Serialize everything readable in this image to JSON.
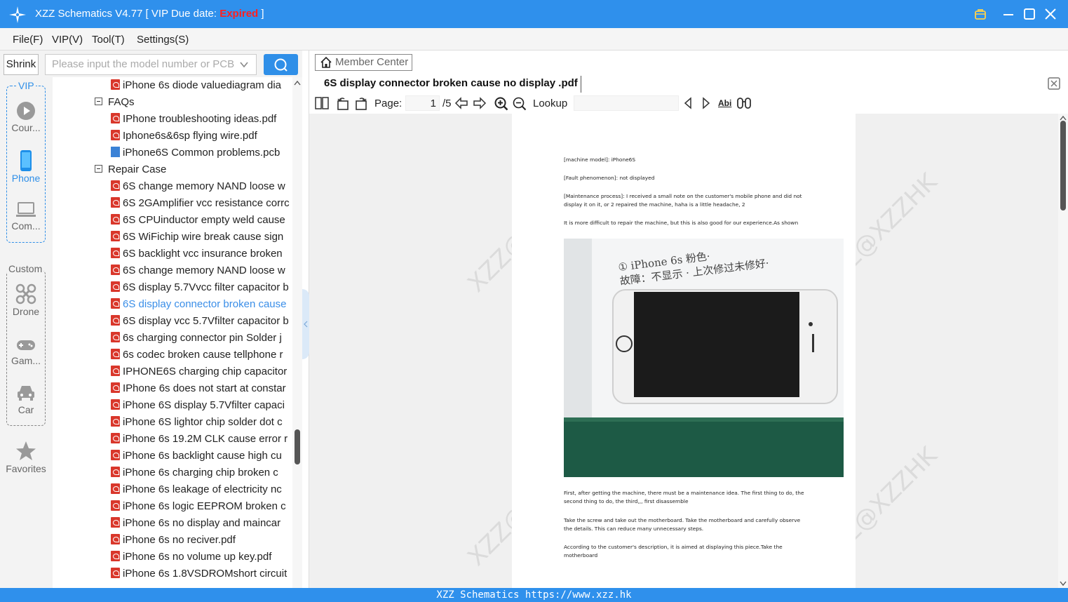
{
  "window": {
    "title_prefix": "XZZ Schematics V4.77 [ VIP Due date: ",
    "title_status": "Expired",
    "title_suffix": " ]"
  },
  "menu": [
    "File(F)",
    "VIP(V)",
    "Tool(T)",
    "Settings(S)"
  ],
  "sidebar": {
    "shrink_label": "Shrink",
    "search_placeholder": "Please input the model number or PCB",
    "vip_group_label": "VIP",
    "custom_group_label": "Custom",
    "items": [
      {
        "label": "Cour...",
        "icon": "play-circle-icon"
      },
      {
        "label": "Phone",
        "icon": "phone-icon"
      },
      {
        "label": "Com...",
        "icon": "laptop-icon"
      },
      {
        "label": "Drone",
        "icon": "drone-icon"
      },
      {
        "label": "Gam...",
        "icon": "gamepad-icon"
      },
      {
        "label": "Car",
        "icon": "car-icon"
      },
      {
        "label": "Favorites",
        "icon": "star-icon"
      }
    ]
  },
  "tree": {
    "nodes": [
      {
        "type": "pdf",
        "label": "iPhone 6s diode valuediagram dia"
      },
      {
        "type": "folder",
        "label": "FAQs"
      },
      {
        "type": "pdf",
        "label": "IPhone troubleshooting ideas.pdf"
      },
      {
        "type": "pdf",
        "label": "Iphone6s&6sp flying wire.pdf"
      },
      {
        "type": "pcb",
        "label": "iPhone6S Common problems.pcb"
      },
      {
        "type": "folder",
        "label": "Repair Case"
      },
      {
        "type": "pdf",
        "label": "6S  change memory NAND loose w"
      },
      {
        "type": "pdf",
        "label": "6S 2GAmplifier vcc resistance corrc"
      },
      {
        "type": "pdf",
        "label": "6S CPUinductor empty weld cause"
      },
      {
        "type": "pdf",
        "label": "6S WiFichip wire break  cause sign"
      },
      {
        "type": "pdf",
        "label": "6S backlight vcc insurance broken"
      },
      {
        "type": "pdf",
        "label": "6S change memory NAND loose w"
      },
      {
        "type": "pdf",
        "label": "6S display 5.7Vvcc filter capacitor b"
      },
      {
        "type": "pdf",
        "label": "6S display connector broken cause",
        "selected": true
      },
      {
        "type": "pdf",
        "label": "6S display vcc 5.7Vfilter capacitor b"
      },
      {
        "type": "pdf",
        "label": "6s charging connector pin Solder j"
      },
      {
        "type": "pdf",
        "label": "6s codec broken cause tellphone r"
      },
      {
        "type": "pdf",
        "label": "IPHONE6S charging chip capacitor"
      },
      {
        "type": "pdf",
        "label": "IPhone 6s does not start at constar"
      },
      {
        "type": "pdf",
        "label": "iPhone 6S display 5.7Vfilter capaci"
      },
      {
        "type": "pdf",
        "label": "iPhone 6S lightor chip solder dot c"
      },
      {
        "type": "pdf",
        "label": "iPhone 6s  19.2M CLK cause error r"
      },
      {
        "type": "pdf",
        "label": "iPhone 6s  backlight cause high cu"
      },
      {
        "type": "pdf",
        "label": "iPhone 6s  charging chip broken c"
      },
      {
        "type": "pdf",
        "label": "iPhone 6s  leakage of electricity nc"
      },
      {
        "type": "pdf",
        "label": "iPhone 6s  logic EEPROM broken c"
      },
      {
        "type": "pdf",
        "label": "iPhone 6s  no display and maincar"
      },
      {
        "type": "pdf",
        "label": "iPhone 6s  no reciver.pdf"
      },
      {
        "type": "pdf",
        "label": "iPhone 6s  no volume up key.pdf"
      },
      {
        "type": "pdf",
        "label": "iPhone 6s 1.8VSDROMshort circuit"
      }
    ]
  },
  "viewer": {
    "member_center": "Member Center",
    "doc_tab": "6S display connector broken cause no display  .pdf",
    "page_label": "Page:",
    "page_current": "1",
    "page_total": "/5",
    "lookup_label": "Lookup",
    "abi_label": "Abi",
    "watermark": "XZZ@XZZHK",
    "page_text": [
      "[machine model]: iPhone6S",
      "[Fault phenomenon]: not displayed",
      "[Maintenance process]: I received a small note on the customer's mobile phone and did not display it on it, or 2 repaired the machine, haha is a little headache, 2",
      "It is more difficult to repair the machine, but this is also good for our experience.As shown",
      "First, after getting the machine, there must be a maintenance idea. The first thing to do, the second thing to do, the third,,, first disassemble",
      "Take the screw and take out the motherboard. Take the motherboard and carefully observe the details. This can reduce many unnecessary steps.",
      "According to the customer's description, it is aimed at displaying this piece.Take the motherboard"
    ],
    "photo_note": "① iPhone 6s 粉色·\n故障：不显示 · 上次修过未修好·"
  },
  "status_bar": "XZZ Schematics https://www.xzz.hk",
  "colors": {
    "accent": "#2f90ec",
    "expired": "#ff2020",
    "pdf_icon": "#d9372b",
    "selected_text": "#3a8ee8"
  }
}
